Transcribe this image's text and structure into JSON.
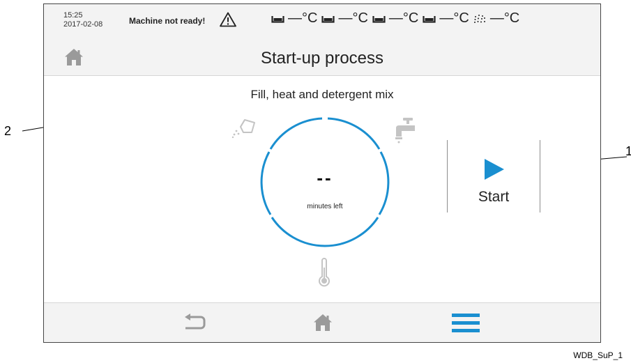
{
  "status": {
    "time": "15:25",
    "date": "2017-02-08",
    "warning": "Machine not ready!",
    "temps": [
      {
        "icon": "tank-icon",
        "value": "—°C"
      },
      {
        "icon": "tank-icon",
        "value": "—°C"
      },
      {
        "icon": "tank-icon",
        "value": "—°C"
      },
      {
        "icon": "tank-icon",
        "value": "—°C"
      },
      {
        "icon": "spray-icon",
        "value": "—°C"
      }
    ]
  },
  "header": {
    "title": "Start-up process"
  },
  "main": {
    "step_title": "Fill, heat and detergent mix",
    "dial": {
      "value": "--",
      "label": "minutes left",
      "progress": 0
    },
    "start_label": "Start",
    "process_icons": [
      "detergent-icon",
      "tap-icon",
      "thermometer-icon"
    ]
  },
  "callouts": {
    "one": "1",
    "two": "2"
  },
  "caption": "WDB_SuP_1",
  "colors": {
    "accent": "#1a8fd0",
    "icon_gray": "#c4c4c4",
    "bar_bg": "#f3f3f3"
  }
}
